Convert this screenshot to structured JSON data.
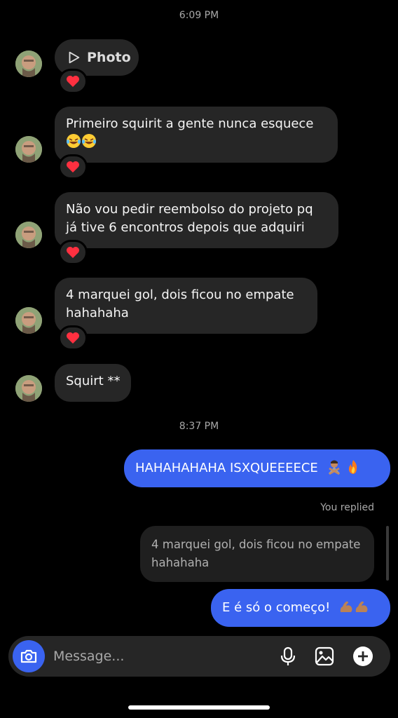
{
  "thread": {
    "timestamps": [
      "6:09 PM",
      "8:37 PM"
    ],
    "incoming": {
      "photo_label": "Photo",
      "msg1": "Primeiro squirit a gente nunca esquece",
      "msg2_line1": "Não vou pedir reembolso do projeto pq",
      "msg2_line2": "já tive 6 encontros depois que adquiri",
      "msg3_line1": "4 marquei gol, dois ficou no empate",
      "msg3_line2": "hahahaha",
      "msg4": "Squirt **"
    },
    "outgoing": {
      "msg1": "HAHAHAHAHA ISXQUEEEECE",
      "replied_label": "You replied",
      "reply_line1": "4 marquei gol, dois ficou no empate",
      "reply_line2": "hahahaha",
      "msg2": "E é só o começo!"
    },
    "reaction_icon": "heart-icon"
  },
  "composer": {
    "placeholder": "Message..."
  },
  "colors": {
    "accent": "#3a63f0",
    "bubble_in": "#262626",
    "background": "#000000",
    "reaction": "#ff3040"
  }
}
